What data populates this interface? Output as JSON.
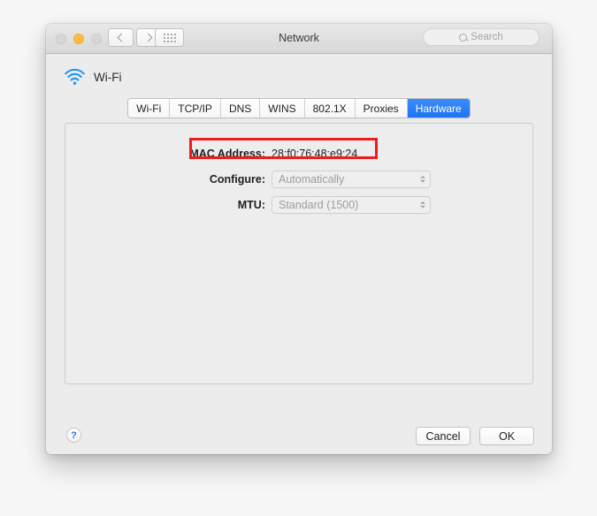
{
  "window": {
    "title": "Network",
    "traffic_lights": [
      {
        "name": "close",
        "color": "#d6d6d6"
      },
      {
        "name": "minimize",
        "color": "#fcbc40"
      },
      {
        "name": "zoom",
        "color": "#d6d6d6"
      }
    ],
    "toolbar": {
      "back_icon": "chevron-left-icon",
      "forward_icon": "chevron-right-icon",
      "show_all_icon": "grid-icon",
      "search": {
        "placeholder": "Search",
        "value": "",
        "icon": "search-icon"
      }
    }
  },
  "service": {
    "icon": "wifi-icon",
    "icon_color": "#2196f3",
    "name": "Wi-Fi"
  },
  "tabs": [
    {
      "label": "Wi-Fi",
      "selected": false
    },
    {
      "label": "TCP/IP",
      "selected": false
    },
    {
      "label": "DNS",
      "selected": false
    },
    {
      "label": "WINS",
      "selected": false
    },
    {
      "label": "802.1X",
      "selected": false
    },
    {
      "label": "Proxies",
      "selected": false
    },
    {
      "label": "Hardware",
      "selected": true
    }
  ],
  "selected_tab_color": "#2d7ff9",
  "hardware": {
    "mac_address": {
      "label": "MAC Address:",
      "value": "28:f0:76:48:e9:24",
      "highlighted": true,
      "highlight_color": "#ef1c1c"
    },
    "configure": {
      "label": "Configure:",
      "value": "Automatically",
      "enabled": false,
      "stepper_icon": "chevron-up-down-icon"
    },
    "mtu": {
      "label": "MTU:",
      "value": "Standard  (1500)",
      "enabled": false,
      "stepper_icon": "chevron-up-down-icon"
    }
  },
  "footer": {
    "help_label": "?",
    "cancel_label": "Cancel",
    "ok_label": "OK"
  }
}
